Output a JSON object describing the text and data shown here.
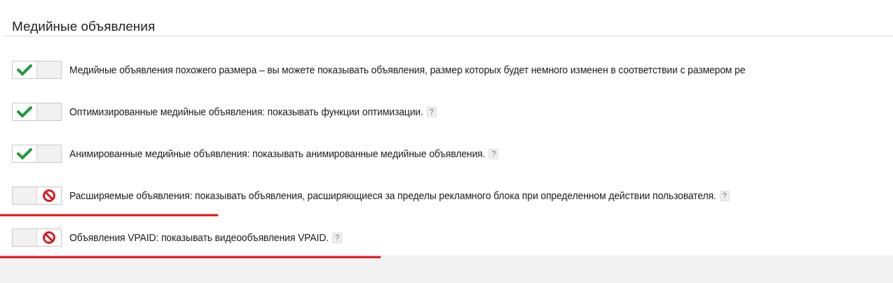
{
  "section": {
    "title": "Медийные объявления"
  },
  "options": [
    {
      "label": "Медийные объявления похожего размера – вы можете показывать объявления, размер которых будет немного изменен в соответствии с размером ре",
      "enabled": true,
      "underlined": false
    },
    {
      "label": "Оптимизированные медийные объявления: показывать функции оптимизации.",
      "help": "?",
      "enabled": true,
      "underlined": false
    },
    {
      "label": "Анимированные медийные объявления: показывать анимированные медийные объявления.",
      "help": "?",
      "enabled": true,
      "underlined": false
    },
    {
      "label": "Расширяемые объявления: показывать объявления, расширяющиеся за пределы рекламного блока при определенном действии пользователя.",
      "help": "?",
      "enabled": false,
      "underlined": true
    },
    {
      "label": "Объявления VPAID: показывать видеообъявления VPAID.",
      "help": "?",
      "enabled": false,
      "underlined": true
    }
  ]
}
